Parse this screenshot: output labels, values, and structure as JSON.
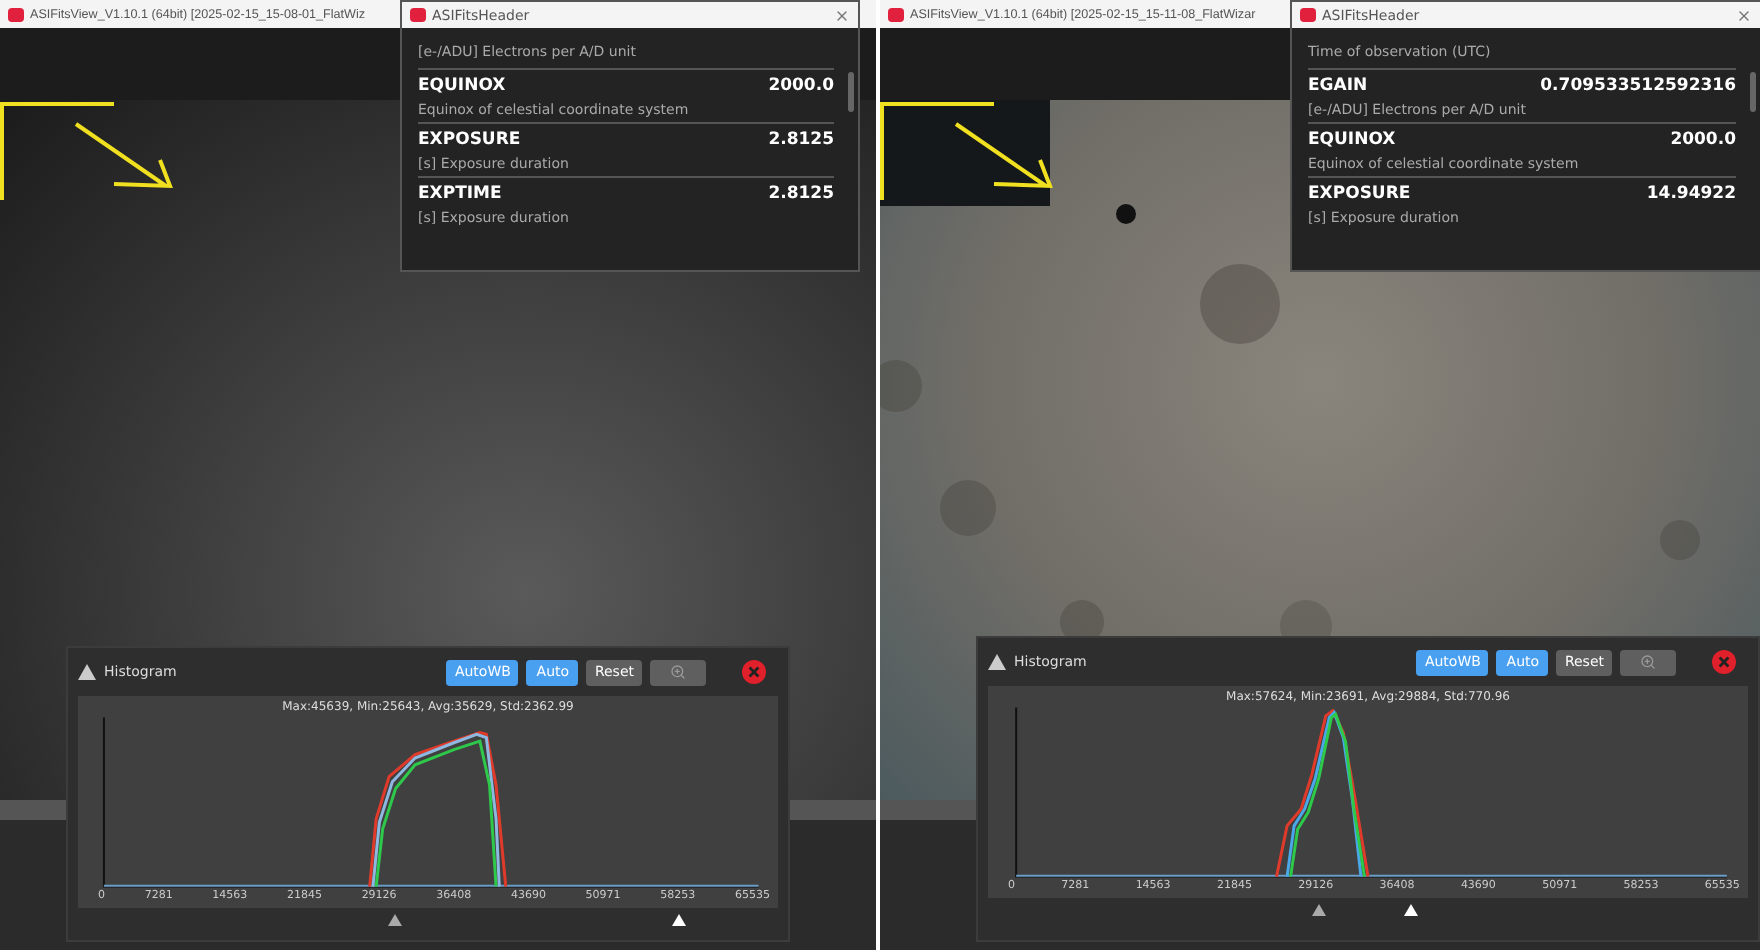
{
  "windows": [
    {
      "title": "ASIFitsView_V1.10.1 (64bit) [2025-02-15_15-08-01_FlatWiz",
      "image": {
        "kind": "smooth"
      },
      "header_panel": {
        "title": "ASIFitsHeader",
        "partial_description": "[e-/ADU] Electrons per A/D unit",
        "entries": [
          {
            "key": "EQUINOX",
            "value": "2000.0",
            "description": "Equinox of celestial coordinate system"
          },
          {
            "key": "EXPOSURE",
            "value": "2.8125",
            "description": "[s] Exposure duration"
          },
          {
            "key": "EXPTIME",
            "value": "2.8125",
            "description": "[s] Exposure duration"
          }
        ]
      },
      "histogram": {
        "title": "Histogram",
        "buttons": [
          {
            "label": "AutoWB",
            "active": true
          },
          {
            "label": "Auto",
            "active": true
          },
          {
            "label": "Reset",
            "active": false
          }
        ],
        "stats": "Max:45639, Min:25643, Avg:35629, Std:2362.99",
        "curve": {
          "kind": "plateau"
        },
        "x_labels": [
          "0",
          "7281",
          "14563",
          "21845",
          "29126",
          "36408",
          "43690",
          "50971",
          "58253",
          "65535"
        ],
        "handles": [
          {
            "level": 0.45
          },
          {
            "level": 0.89
          }
        ]
      }
    },
    {
      "title": "ASIFitsView_V1.10.1 (64bit) [2025-02-15_15-11-08_FlatWizar",
      "image": {
        "kind": "dusty"
      },
      "header_panel": {
        "title": "ASIFitsHeader",
        "partial_description": "Time of observation (UTC)",
        "entries": [
          {
            "key": "EGAIN",
            "value": "0.709533512592316",
            "description": "[e-/ADU] Electrons per A/D unit"
          },
          {
            "key": "EQUINOX",
            "value": "2000.0",
            "description": "Equinox of celestial coordinate system"
          },
          {
            "key": "EXPOSURE",
            "value": "14.94922",
            "description": "[s] Exposure duration"
          }
        ]
      },
      "histogram": {
        "title": "Histogram",
        "buttons": [
          {
            "label": "AutoWB",
            "active": true
          },
          {
            "label": "Auto",
            "active": true
          },
          {
            "label": "Reset",
            "active": false
          }
        ],
        "stats": "Max:57624, Min:23691, Avg:29884, Std:770.96",
        "curve": {
          "kind": "peak"
        },
        "x_labels": [
          "0",
          "7281",
          "14563",
          "21845",
          "29126",
          "36408",
          "43690",
          "50971",
          "58253",
          "65535"
        ],
        "handles": [
          {
            "level": 0.43
          },
          {
            "level": 0.56
          }
        ]
      }
    }
  ]
}
